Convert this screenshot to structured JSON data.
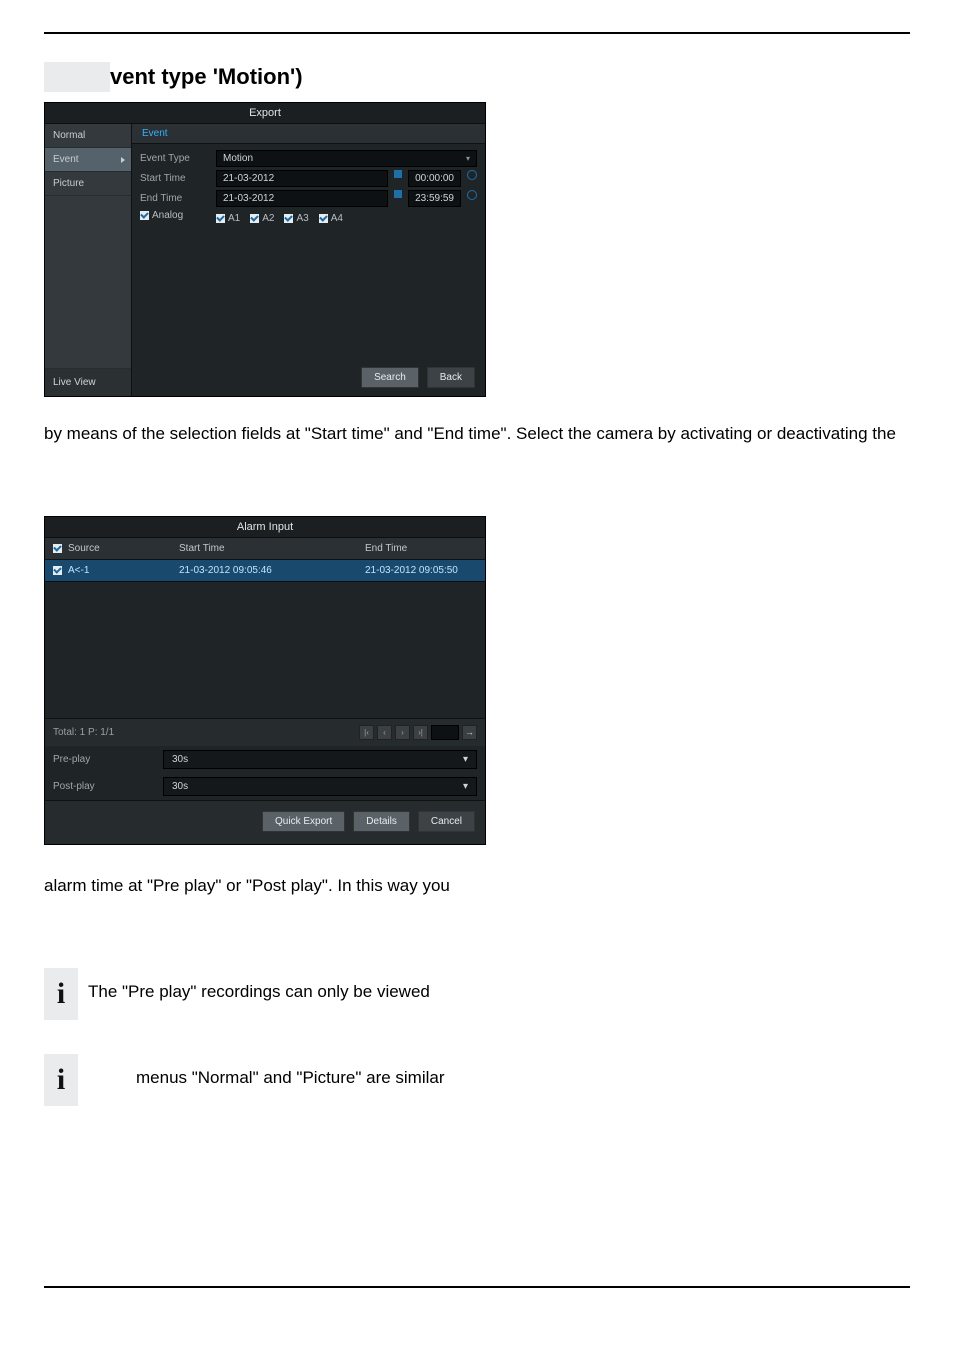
{
  "header": {
    "heading": "vent type 'Motion')"
  },
  "export_shot": {
    "title": "Export",
    "side": {
      "normal": "Normal",
      "event": "Event",
      "picture": "Picture",
      "live": "Live View"
    },
    "tab": "Event",
    "fields": {
      "event_type_label": "Event Type",
      "event_type_value": "Motion",
      "start_time_label": "Start Time",
      "start_date": "21-03-2012",
      "start_time": "00:00:00",
      "end_time_label": "End Time",
      "end_date": "21-03-2012",
      "end_time": "23:59:59",
      "analog_label": "Analog",
      "a_checks": [
        "A1",
        "A2",
        "A3",
        "A4"
      ]
    },
    "buttons": {
      "search": "Search",
      "back": "Back"
    }
  },
  "para1": "by means of the selection fields at \"Start time\" and \"End time\". Select the camera by activating or deactivating the",
  "alarm_shot": {
    "title": "Alarm Input",
    "head": {
      "source": "Source",
      "start": "Start Time",
      "end": "End Time"
    },
    "row": {
      "source": "A<-1",
      "start": "21-03-2012 09:05:46",
      "end": "21-03-2012 09:05:50"
    },
    "total": "Total: 1  P: 1/1",
    "pager_go": "→",
    "pre_label": "Pre-play",
    "pre_value": "30s",
    "post_label": "Post-play",
    "post_value": "30s",
    "buttons": {
      "quick": "Quick Export",
      "details": "Details",
      "cancel": "Cancel"
    }
  },
  "para2": "alarm time at \"Pre play\" or \"Post play\". In this way you",
  "notes": {
    "icon": "i",
    "n1": "The \"Pre play\" recordings can only be viewed",
    "n2": "menus \"Normal\" and \"Picture\" are similar"
  }
}
